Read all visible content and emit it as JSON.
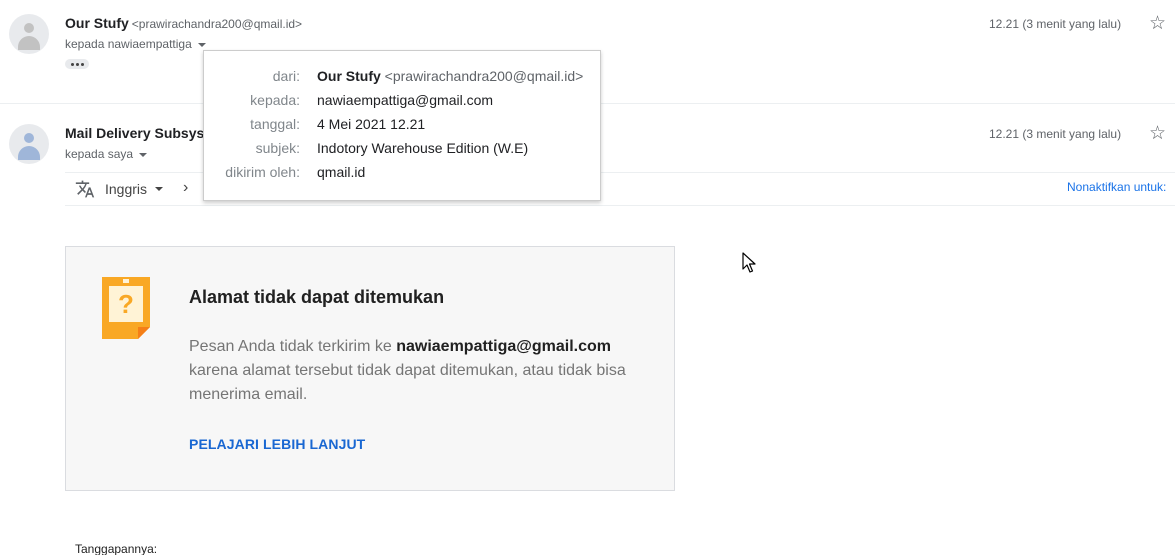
{
  "message1": {
    "sender_name": "Our Stufy",
    "sender_email": "<prawirachandra200@qmail.id>",
    "to_line": "kepada nawiaempattiga",
    "time": "12.21 (3 menit yang lalu)"
  },
  "message2": {
    "sender_name": "Mail Delivery Subsyst",
    "to_line": "kepada saya",
    "time": "12.21 (3 menit yang lalu)"
  },
  "translate": {
    "language": "Inggris",
    "disable_label": "Nonaktifkan untuk:"
  },
  "bounce_card": {
    "title": "Alamat tidak dapat ditemukan",
    "body_prefix": "Pesan Anda tidak terkirim ke",
    "recipient": "nawiaempattiga@gmail.com",
    "body_suffix": "karena alamat tersebut tidak dapat ditemukan, atau tidak bisa menerima email.",
    "learn_more": "PELAJARI LEBIH LANJUT"
  },
  "response_label": "Tanggapannya:",
  "details_popup": {
    "from_label": "dari:",
    "from_name": "Our Stufy",
    "from_email": "<prawirachandra200@qmail.id>",
    "to_label": "kepada:",
    "to_value": "nawiaempattiga@gmail.com",
    "date_label": "tanggal:",
    "date_value": "4 Mei 2021 12.21",
    "subject_label": "subjek:",
    "subject_value": "Indotory Warehouse Edition (W.E)",
    "sent_by_label": "dikirim oleh:",
    "sent_by_value": "qmail.id"
  },
  "colors": {
    "link": "#1967d2",
    "card_bg": "#f7f7f7",
    "note_icon": "#f9a825"
  }
}
